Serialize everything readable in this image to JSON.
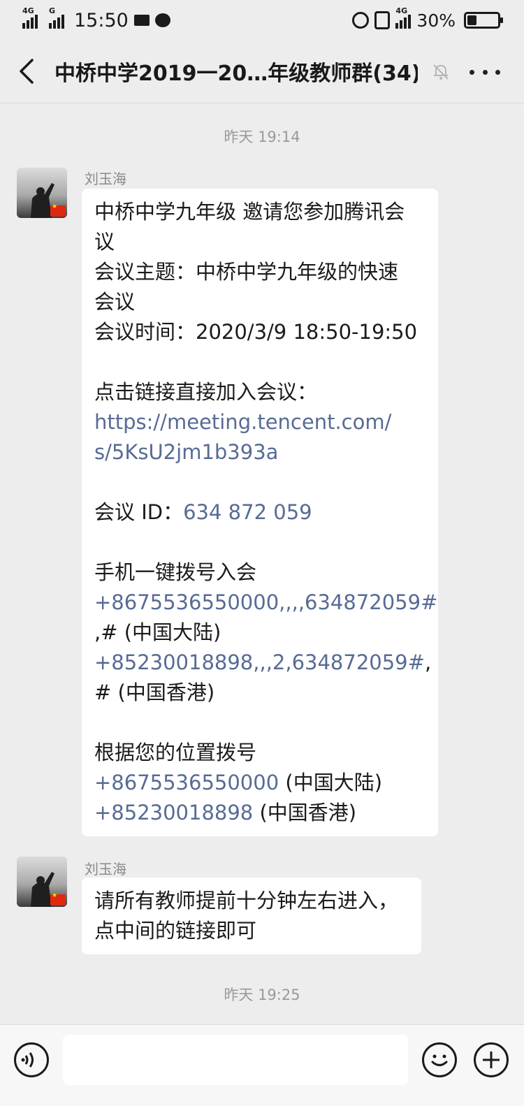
{
  "status_bar": {
    "net1": "4G",
    "net2": "G",
    "time": "15:50",
    "net3": "4G",
    "battery": "30%",
    "battery_level": 0.3
  },
  "header": {
    "title": "中桥中学2019一20…年级教师群(34)"
  },
  "timestamps": [
    "昨天 19:14",
    "昨天 19:25"
  ],
  "messages": [
    {
      "sender": "刘玉海",
      "lines": [
        "中桥中学九年级 邀请您参加腾讯会",
        "议",
        "会议主题：中桥中学九年级的快速",
        "会议",
        "会议时间：2020/3/9 18:50-19:50",
        "",
        "点击链接直接加入会议：",
        "https://meeting.tencent.com/",
        "s/5KsU2jm1b393a",
        "",
        "会议 ID：",
        "634 872 059",
        "",
        "手机一键拨号入会",
        "+8675536550000,,,,634872059#",
        ",# (中国大陆)",
        "+85230018898,,,2,634872059#",
        ",",
        "# (中国香港)",
        "",
        "根据您的位置拨号",
        "+8675536550000",
        " (中国大陆)",
        "+85230018898",
        " (中国香港)"
      ]
    },
    {
      "sender": "刘玉海",
      "lines": [
        "请所有教师提前十分钟左右进入，",
        "点中间的链接即可"
      ]
    }
  ]
}
